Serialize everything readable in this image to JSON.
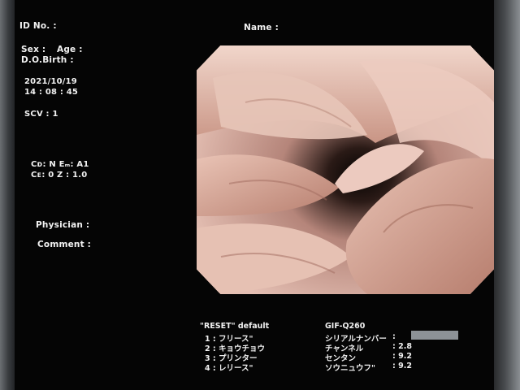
{
  "header": {
    "id_label": "ID No. :",
    "name_label": "Name :"
  },
  "patient": {
    "sex_label": "Sex :",
    "age_label": "Age :",
    "dob_label": "D.O.Birth :",
    "date": "2021/10/19",
    "time": "14 : 08 : 45",
    "scv": "SCV :  1",
    "cf_row": "Cᴅ: N  Eₘ: A1",
    "ce_row": "Cᴇ: 0  Z : 1.0",
    "physician_label": "Physician :",
    "comment_label": "Comment :"
  },
  "settings": {
    "reset": "\"RESET\"  default",
    "items": [
      "1 :  フリース\"",
      "2 :  キョウチョウ",
      "3 :  プリンター",
      "4 :  レリース\""
    ]
  },
  "scope": {
    "model": "GIF-Q260",
    "rows": [
      {
        "label": "シリアルナンバー",
        "value": ":"
      },
      {
        "label": "チャンネル",
        "value": ": 2.8"
      },
      {
        "label": "センタン",
        "value": ": 9.2"
      },
      {
        "label": "ソウニュウフ\"",
        "value": ": 9.2"
      }
    ]
  },
  "colors": {
    "screen": "#050505",
    "text": "#f2f2f2",
    "redaction": "#8d9297"
  }
}
